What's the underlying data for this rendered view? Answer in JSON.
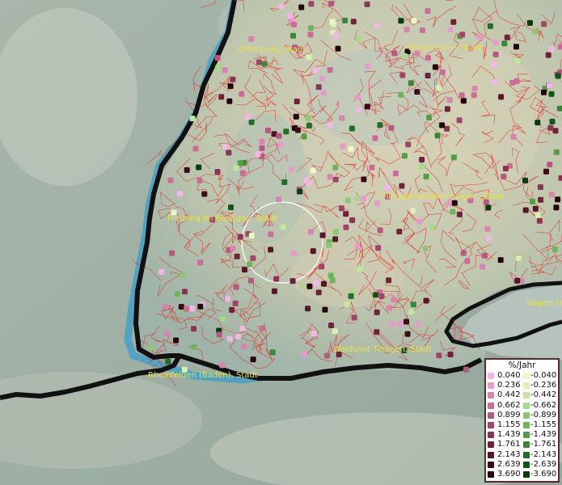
{
  "legend": {
    "title": "%/Jahr",
    "positive": [
      {
        "value": "0.040",
        "color": "#f4b6e6"
      },
      {
        "value": "0.236",
        "color": "#e79acb"
      },
      {
        "value": "0.442",
        "color": "#d983b1"
      },
      {
        "value": "0.662",
        "color": "#c96c97"
      },
      {
        "value": "0.899",
        "color": "#b55a7f"
      },
      {
        "value": "1.155",
        "color": "#9f4667"
      },
      {
        "value": "1.439",
        "color": "#873550"
      },
      {
        "value": "1.761",
        "color": "#6d243a"
      },
      {
        "value": "2.143",
        "color": "#551628"
      },
      {
        "value": "2.639",
        "color": "#3c0b18"
      },
      {
        "value": "3.690",
        "color": "#24030a"
      }
    ],
    "negative": [
      {
        "value": "-0.040",
        "color": "#eef7c6"
      },
      {
        "value": "-0.236",
        "color": "#d9f0b4"
      },
      {
        "value": "-0.442",
        "color": "#c2e5a0"
      },
      {
        "value": "-0.662",
        "color": "#a8d889"
      },
      {
        "value": "-0.899",
        "color": "#8cc672"
      },
      {
        "value": "-1.155",
        "color": "#6fb35b"
      },
      {
        "value": "-1.439",
        "color": "#529e46"
      },
      {
        "value": "-1.761",
        "color": "#388636"
      },
      {
        "value": "-2.143",
        "color": "#236d26"
      },
      {
        "value": "-2.639",
        "color": "#135419"
      },
      {
        "value": "-3.690",
        "color": "#073b0c"
      }
    ]
  },
  "cities": {
    "offenburg": "Offenburg, Stadt",
    "dornstetten": "Dornstetten, Stadt",
    "villingen": "Villingen-Schwenningen, Stadt",
    "freiburg": "Freiburg im Breisgau, Stadt",
    "singen": "Singen (H",
    "waldshut": "Waldshut-Tiengen, Stadt",
    "rheinfelden": "Rheinfelden (Baden), Stadt"
  },
  "colors": {
    "land": "#c7cdb0",
    "lowland": "#9fb8ad",
    "outside": "#8f9c93",
    "boundary": "#e0302e",
    "border": "#111111",
    "river": "#3a9dc8"
  }
}
